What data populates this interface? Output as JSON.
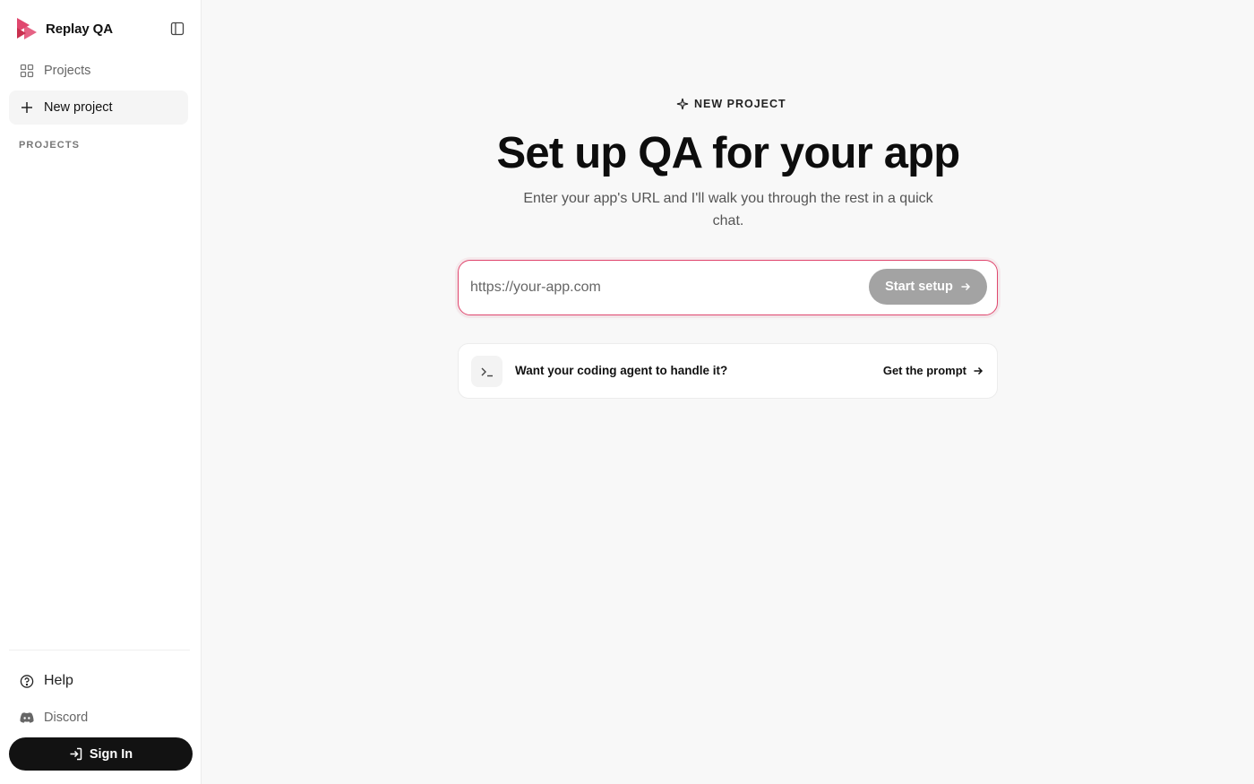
{
  "app": {
    "name": "Replay QA",
    "brand_color": "#e0476e"
  },
  "sidebar": {
    "nav": [
      {
        "label": "Projects",
        "icon": "grid-icon"
      },
      {
        "label": "New project",
        "icon": "plus-icon"
      }
    ],
    "section_label": "PROJECTS",
    "footer": {
      "help_label": "Help",
      "discord_label": "Discord",
      "sign_in_label": "Sign In"
    }
  },
  "main": {
    "eyebrow": "NEW PROJECT",
    "headline": "Set up QA for your app",
    "subtitle": "Enter your app's URL and I'll walk you through the rest in a quick chat.",
    "url_input": {
      "placeholder": "https://your-app.com",
      "value": ""
    },
    "start_button_label": "Start setup",
    "agent_card": {
      "text": "Want your coding agent to handle it?",
      "link_label": "Get the prompt"
    }
  }
}
